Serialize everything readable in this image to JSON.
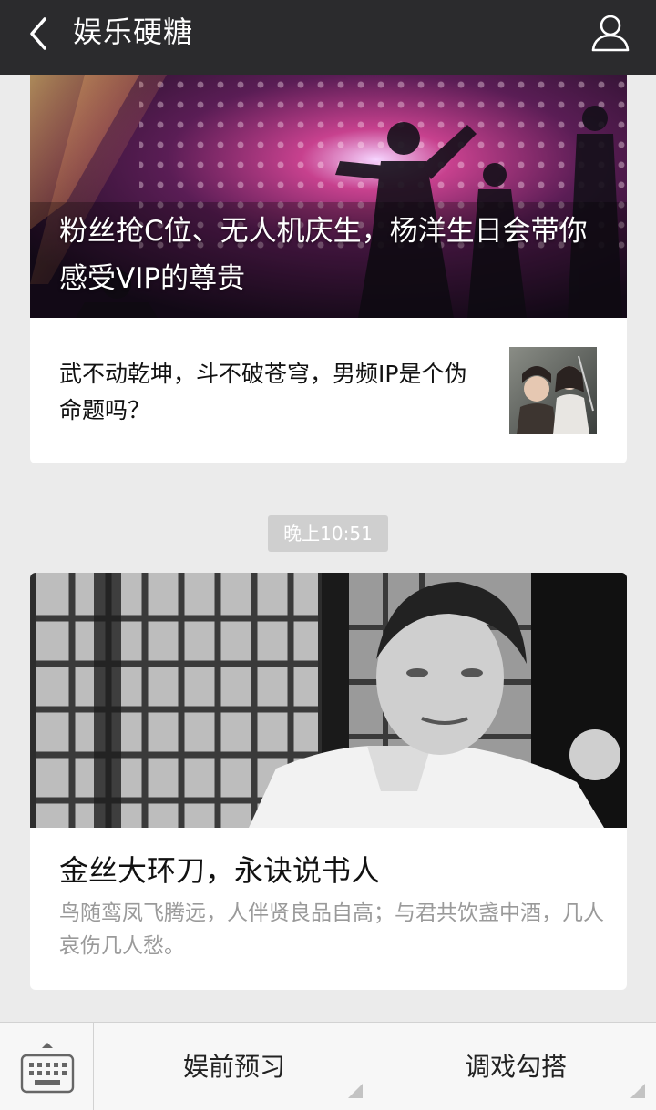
{
  "header": {
    "title": "娱乐硬糖"
  },
  "feed": {
    "card1": {
      "cover_title": "粉丝抢C位、无人机庆生，杨洋生日会带你感受VIP的尊贵",
      "sub_item_title": "武不动乾坤，斗不破苍穹，男频IP是个伪命题吗？"
    },
    "timestamp": "晚上10:51",
    "card2": {
      "title": "金丝大环刀，永诀说书人",
      "description": "鸟随鸾凤飞腾远，人伴贤良品自高；与君共饮盏中酒，几人哀伤几人愁。"
    }
  },
  "bottom_menu": {
    "keyboard_icon": "keyboard-icon",
    "items": [
      {
        "label": "娱前预习"
      },
      {
        "label": "调戏勾搭"
      }
    ]
  },
  "colors": {
    "header_bg": "#2b2b2d",
    "page_bg": "#ebebeb",
    "timestamp_bg": "#cfcfcf",
    "desc_text": "#9a9a9a"
  }
}
